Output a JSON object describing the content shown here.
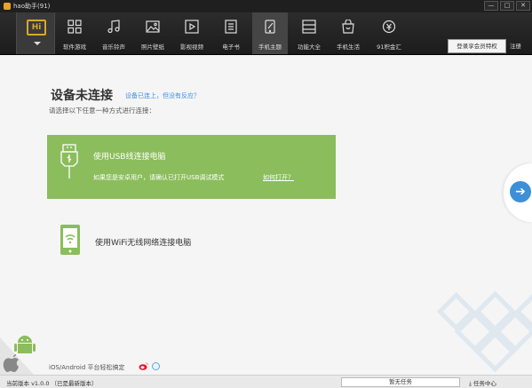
{
  "window": {
    "title": "hao助手(91)",
    "controls": [
      "—",
      "□",
      "✕"
    ]
  },
  "toolbar": {
    "nav": [
      {
        "label": "软件游戏",
        "icon": "apps-grid-icon"
      },
      {
        "label": "音乐铃声",
        "icon": "music-note-icon"
      },
      {
        "label": "照片壁纸",
        "icon": "photo-icon"
      },
      {
        "label": "影视视频",
        "icon": "film-icon"
      },
      {
        "label": "电子书",
        "icon": "book-icon"
      },
      {
        "label": "手机主题",
        "icon": "theme-icon"
      },
      {
        "label": "功能大全",
        "icon": "list-icon"
      },
      {
        "label": "手机生活",
        "icon": "shopping-bag-icon"
      },
      {
        "label": "91积金汇",
        "icon": "coins-icon"
      }
    ],
    "active_index": 5,
    "login_label": "登录享会员特权",
    "register_label": "注册"
  },
  "main": {
    "heading": "设备未连接",
    "help_link": "设备已连上，但没有反应？",
    "subtitle": "请选择以下任意一种方式进行连接：",
    "usb": {
      "title": "使用USB线连接电脑",
      "description": "如果您是安卓用户，请确认已打开USB调试模式",
      "link": "如何打开？"
    },
    "wifi": {
      "title": "使用WiFi无线网络连接电脑"
    },
    "platform_text": "iOS/Android 平台轻松搞定"
  },
  "status": {
    "version": "当前版本 v1.0.0 （已是最新版本）",
    "tasks": "暂无任务",
    "task_center": "任务中心"
  },
  "colors": {
    "accent_green": "#8bbd5c",
    "accent_blue": "#3d8fd8",
    "logo_gold": "#d8a82a",
    "toolbar_dark": "#262626"
  }
}
